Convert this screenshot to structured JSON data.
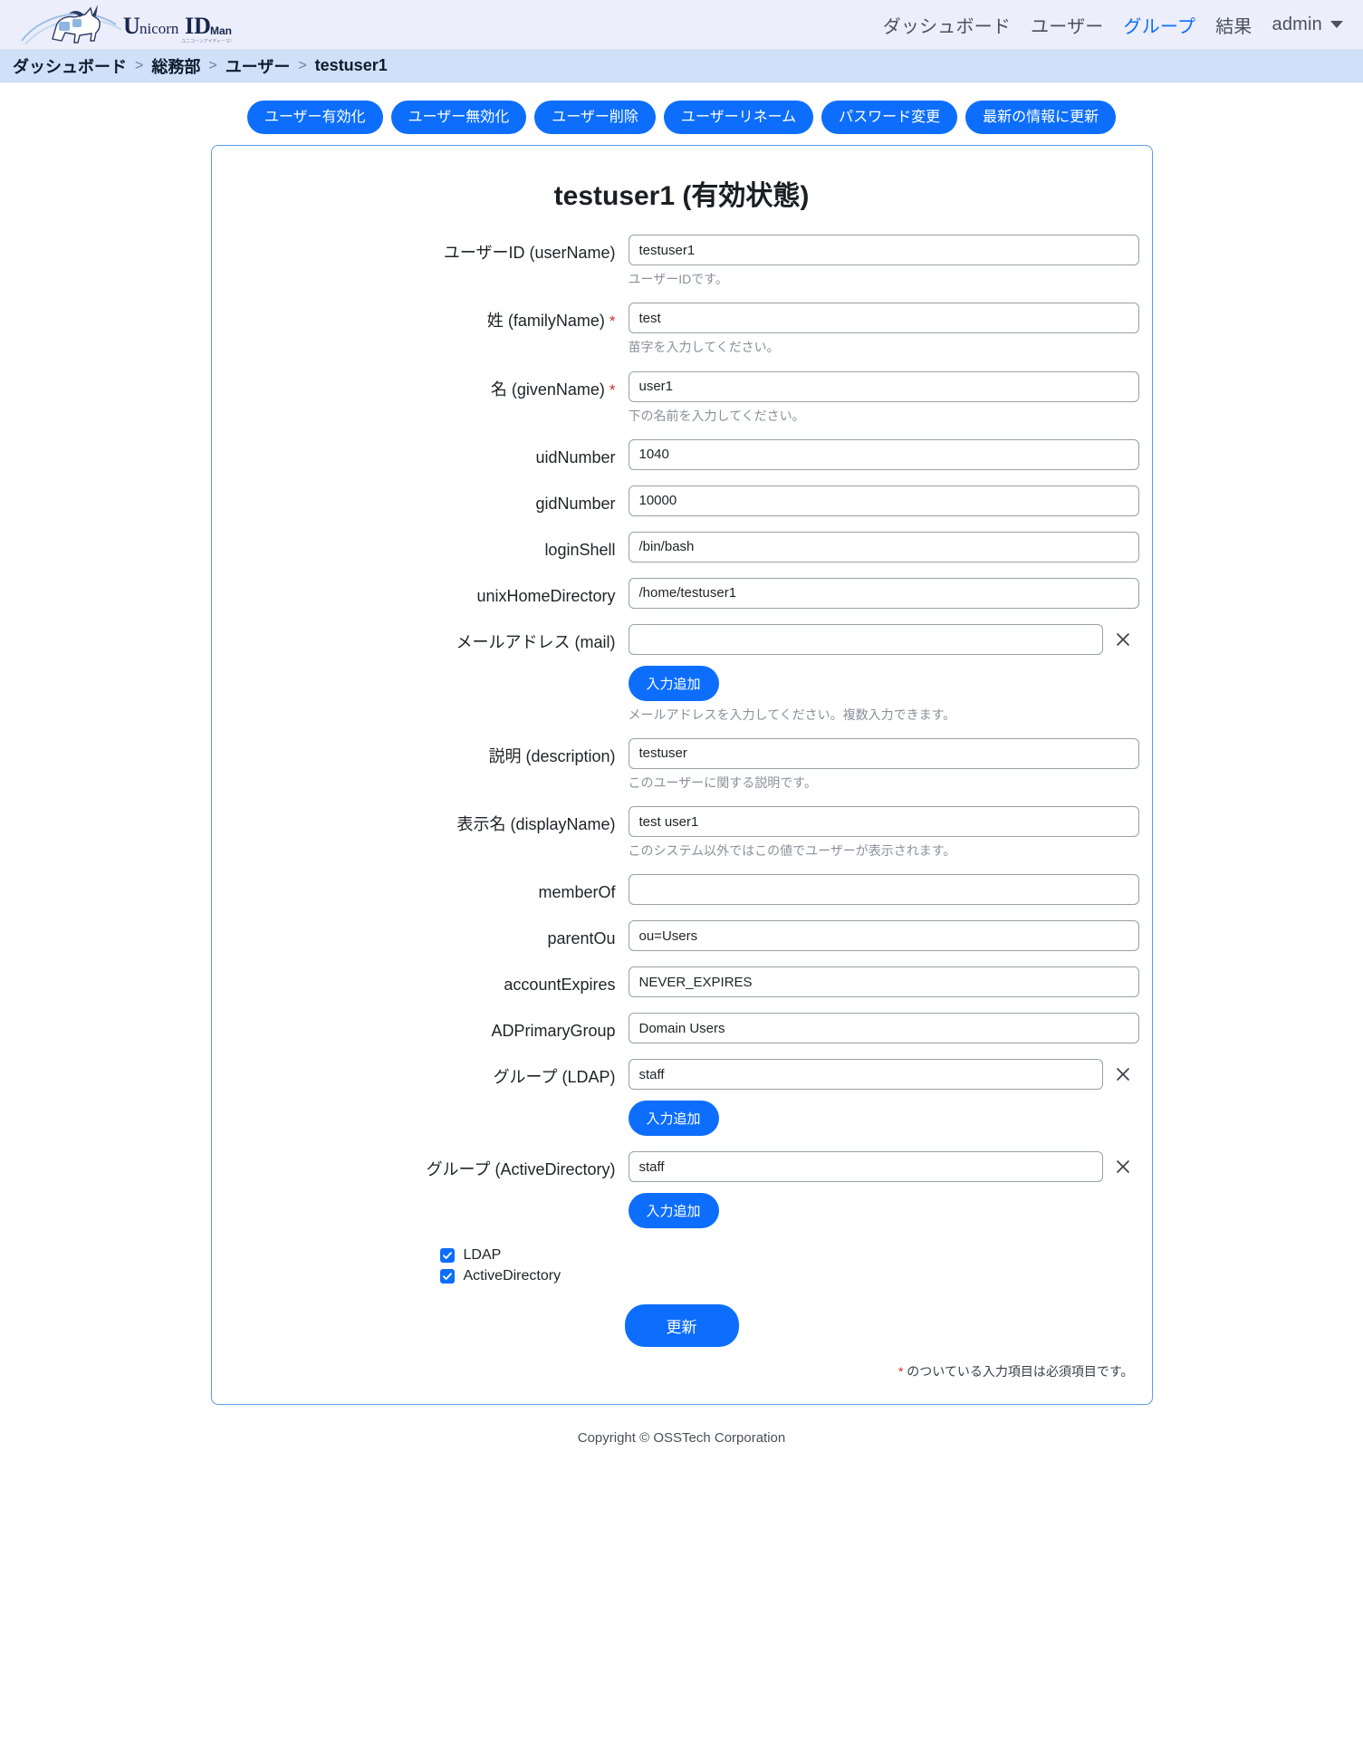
{
  "brand": {
    "name_unicorn": "Unicorn",
    "name_id": "ID",
    "name_manager": "Manager",
    "sub": "ユニコーンアイディーマネージャー"
  },
  "nav": {
    "links": [
      {
        "label": "ダッシュボード",
        "active": false
      },
      {
        "label": "ユーザー",
        "active": false
      },
      {
        "label": "グループ",
        "active": true
      },
      {
        "label": "結果",
        "active": false
      }
    ],
    "user": "admin",
    "caret_icon": "chevron-down-icon"
  },
  "breadcrumb": {
    "separator": ">",
    "items": [
      "ダッシュボード",
      "総務部",
      "ユーザー",
      "testuser1"
    ]
  },
  "actions": [
    "ユーザー有効化",
    "ユーザー無効化",
    "ユーザー削除",
    "ユーザーリネーム",
    "パスワード変更",
    "最新の情報に更新"
  ],
  "card": {
    "title": "testuser1  (有効状態)",
    "fields": [
      {
        "label": "ユーザーID (userName)",
        "required": false,
        "value": "testuser1",
        "placeholder": "",
        "help": "ユーザーIDです。",
        "removable": false,
        "add_button": null
      },
      {
        "label": "姓 (familyName)",
        "required": true,
        "value": "test",
        "placeholder": "",
        "help": "苗字を入力してください。",
        "removable": false,
        "add_button": null
      },
      {
        "label": "名 (givenName)",
        "required": true,
        "value": "user1",
        "placeholder": "",
        "help": "下の名前を入力してください。",
        "removable": false,
        "add_button": null
      },
      {
        "label": "uidNumber",
        "required": false,
        "value": "1040",
        "placeholder": "",
        "help": "",
        "removable": false,
        "add_button": null
      },
      {
        "label": "gidNumber",
        "required": false,
        "value": "10000",
        "placeholder": "",
        "help": "",
        "removable": false,
        "add_button": null
      },
      {
        "label": "loginShell",
        "required": false,
        "value": "/bin/bash",
        "placeholder": "",
        "help": "",
        "removable": false,
        "add_button": null
      },
      {
        "label": "unixHomeDirectory",
        "required": false,
        "value": "/home/testuser1",
        "placeholder": "",
        "help": "",
        "removable": false,
        "add_button": null
      },
      {
        "label": "メールアドレス (mail)",
        "required": false,
        "value": "",
        "placeholder": "",
        "help": "メールアドレスを入力してください。複数入力できます。",
        "removable": true,
        "add_button": "入力追加"
      },
      {
        "label": "説明 (description)",
        "required": false,
        "value": "testuser",
        "placeholder": "",
        "help": "このユーザーに関する説明です。",
        "removable": false,
        "add_button": null
      },
      {
        "label": "表示名 (displayName)",
        "required": false,
        "value": "test user1",
        "placeholder": "",
        "help": "このシステム以外ではこの値でユーザーが表示されます。",
        "removable": false,
        "add_button": null
      },
      {
        "label": "memberOf",
        "required": false,
        "value": "",
        "placeholder": "",
        "help": "",
        "removable": false,
        "add_button": null
      },
      {
        "label": "parentOu",
        "required": false,
        "value": "ou=Users",
        "placeholder": "",
        "help": "",
        "removable": false,
        "add_button": null
      },
      {
        "label": "accountExpires",
        "required": false,
        "value": "NEVER_EXPIRES",
        "placeholder": "",
        "help": "",
        "removable": false,
        "add_button": null
      },
      {
        "label": "ADPrimaryGroup",
        "required": false,
        "value": "Domain Users",
        "placeholder": "",
        "help": "",
        "removable": false,
        "add_button": null
      },
      {
        "label": "グループ (LDAP)",
        "required": false,
        "value": "staff",
        "placeholder": "",
        "help": "",
        "removable": true,
        "add_button": "入力追加"
      },
      {
        "label": "グループ (ActiveDirectory)",
        "required": false,
        "value": "staff",
        "placeholder": "",
        "help": "",
        "removable": true,
        "add_button": "入力追加"
      }
    ],
    "checkboxes": [
      {
        "label": "LDAP",
        "checked": true
      },
      {
        "label": "ActiveDirectory",
        "checked": true
      }
    ],
    "submit_label": "更新",
    "required_note_star": "*",
    "required_note": " のついている入力項目は必須項目です。"
  },
  "footer": {
    "copyright": "Copyright © OSSTech Corporation"
  },
  "colors": {
    "accent": "#0d6efd",
    "navbar_bg": "#eceefc",
    "breadcrumb_bg": "#cfe0f8",
    "required_star": "#e02424",
    "card_border": "#5b9ded"
  }
}
